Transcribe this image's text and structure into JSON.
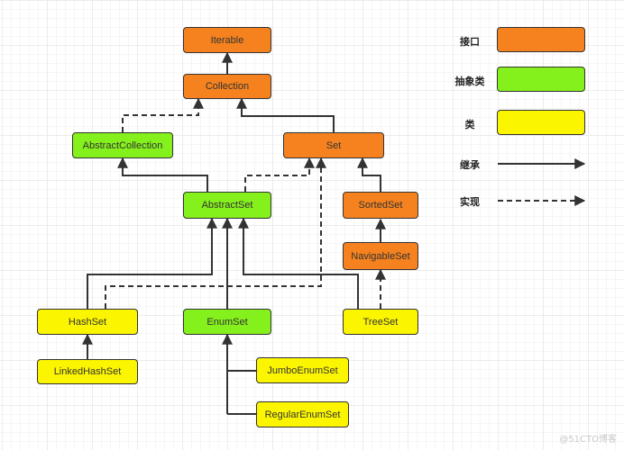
{
  "colors": {
    "interface": "#f5821f",
    "abstract_class": "#84f01c",
    "class": "#fcf500",
    "stroke": "#333333"
  },
  "nodes": {
    "iterable": {
      "label": "Iterable",
      "kind": "interface"
    },
    "collection": {
      "label": "Collection",
      "kind": "interface"
    },
    "abstract_collection": {
      "label": "AbstractCollection",
      "kind": "abstract_class"
    },
    "set": {
      "label": "Set",
      "kind": "interface"
    },
    "abstract_set": {
      "label": "AbstractSet",
      "kind": "abstract_class"
    },
    "sorted_set": {
      "label": "SortedSet",
      "kind": "interface"
    },
    "navigable_set": {
      "label": "NavigableSet",
      "kind": "interface"
    },
    "hash_set": {
      "label": "HashSet",
      "kind": "class"
    },
    "enum_set": {
      "label": "EnumSet",
      "kind": "abstract_class"
    },
    "tree_set": {
      "label": "TreeSet",
      "kind": "class"
    },
    "linked_hash_set": {
      "label": "LinkedHashSet",
      "kind": "class"
    },
    "jumbo_enum_set": {
      "label": "JumboEnumSet",
      "kind": "class"
    },
    "regular_enum_set": {
      "label": "RegularEnumSet",
      "kind": "class"
    }
  },
  "edges": [
    {
      "from": "Collection",
      "to": "Iterable",
      "type": "inherit"
    },
    {
      "from": "AbstractCollection",
      "to": "Collection",
      "type": "implement"
    },
    {
      "from": "Set",
      "to": "Collection",
      "type": "inherit"
    },
    {
      "from": "AbstractSet",
      "to": "AbstractCollection",
      "type": "inherit"
    },
    {
      "from": "AbstractSet",
      "to": "Set",
      "type": "implement"
    },
    {
      "from": "SortedSet",
      "to": "Set",
      "type": "inherit"
    },
    {
      "from": "NavigableSet",
      "to": "SortedSet",
      "type": "inherit"
    },
    {
      "from": "HashSet",
      "to": "AbstractSet",
      "type": "inherit"
    },
    {
      "from": "HashSet",
      "to": "Set",
      "type": "implement"
    },
    {
      "from": "EnumSet",
      "to": "AbstractSet",
      "type": "inherit"
    },
    {
      "from": "TreeSet",
      "to": "AbstractSet",
      "type": "inherit"
    },
    {
      "from": "TreeSet",
      "to": "NavigableSet",
      "type": "implement"
    },
    {
      "from": "LinkedHashSet",
      "to": "HashSet",
      "type": "inherit"
    },
    {
      "from": "JumboEnumSet",
      "to": "EnumSet",
      "type": "inherit"
    },
    {
      "from": "RegularEnumSet",
      "to": "EnumSet",
      "type": "inherit"
    }
  ],
  "legend": {
    "interface": "接口",
    "abstract_class": "抽象类",
    "class": "类",
    "inherit": "继承",
    "implement": "实现"
  },
  "watermark": "@51CTO博客"
}
